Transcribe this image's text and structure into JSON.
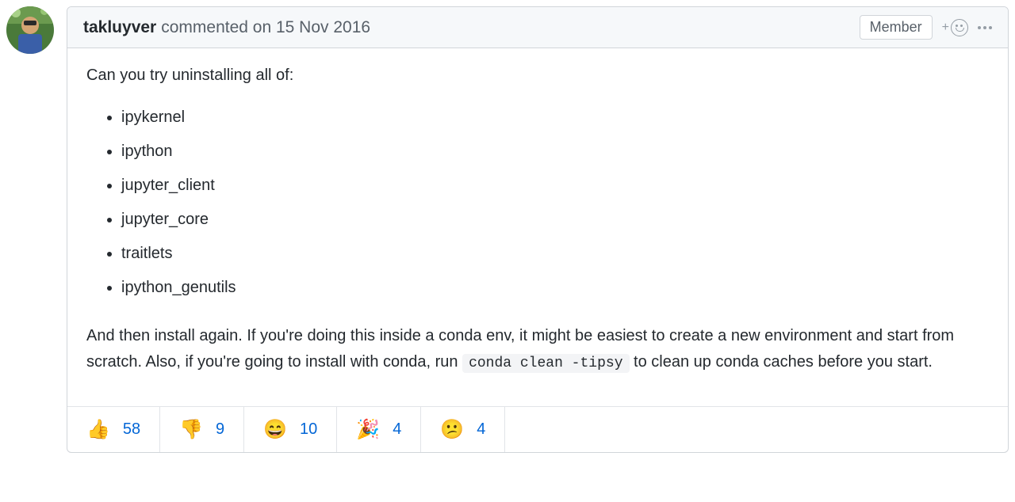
{
  "comment": {
    "author": "takluyver",
    "action_text": "commented on 15 Nov 2016",
    "badge": "Member",
    "body": {
      "intro": "Can you try uninstalling all of:",
      "items": [
        "ipykernel",
        "ipython",
        "jupyter_client",
        "jupyter_core",
        "traitlets",
        "ipython_genutils"
      ],
      "outro_before_code": "And then install again. If you're doing this inside a conda env, it might be easiest to create a new environment and start from scratch. Also, if you're going to install with conda, run ",
      "code": "conda clean -tipsy",
      "outro_after_code": " to clean up conda caches before you start."
    },
    "reactions": [
      {
        "emoji": "👍",
        "count": "58",
        "name": "thumbs-up"
      },
      {
        "emoji": "👎",
        "count": "9",
        "name": "thumbs-down"
      },
      {
        "emoji": "😄",
        "count": "10",
        "name": "laugh"
      },
      {
        "emoji": "🎉",
        "count": "4",
        "name": "hooray"
      },
      {
        "emoji": "😕",
        "count": "4",
        "name": "confused"
      }
    ]
  }
}
